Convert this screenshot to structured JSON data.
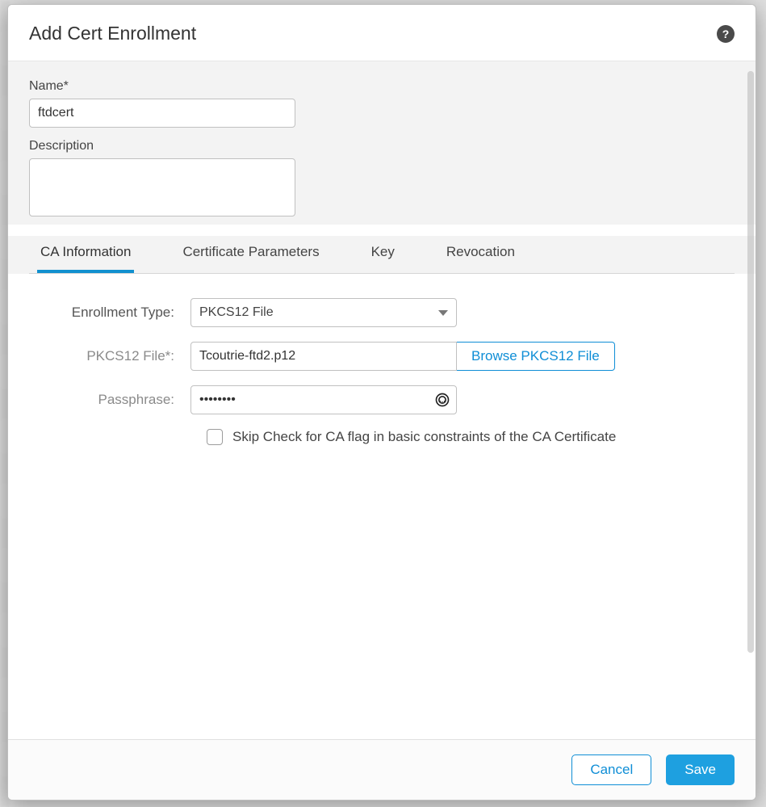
{
  "dialog": {
    "title": "Add Cert Enrollment"
  },
  "form": {
    "name_label": "Name*",
    "name_value": "ftdcert",
    "description_label": "Description",
    "description_value": ""
  },
  "tabs": {
    "items": [
      {
        "label": "CA Information",
        "active": true
      },
      {
        "label": "Certificate Parameters",
        "active": false
      },
      {
        "label": "Key",
        "active": false
      },
      {
        "label": "Revocation",
        "active": false
      }
    ]
  },
  "ca": {
    "enrollment_type_label": "Enrollment Type:",
    "enrollment_type_value": "PKCS12 File",
    "pkcs12_file_label": "PKCS12 File*:",
    "pkcs12_file_value": "Tcoutrie-ftd2.p12",
    "browse_label": "Browse PKCS12 File",
    "passphrase_label": "Passphrase:",
    "passphrase_value": "••••••••",
    "skip_check_label": "Skip Check for CA flag in basic constraints of the CA Certificate",
    "skip_check_checked": false
  },
  "footer": {
    "cancel": "Cancel",
    "save": "Save"
  }
}
